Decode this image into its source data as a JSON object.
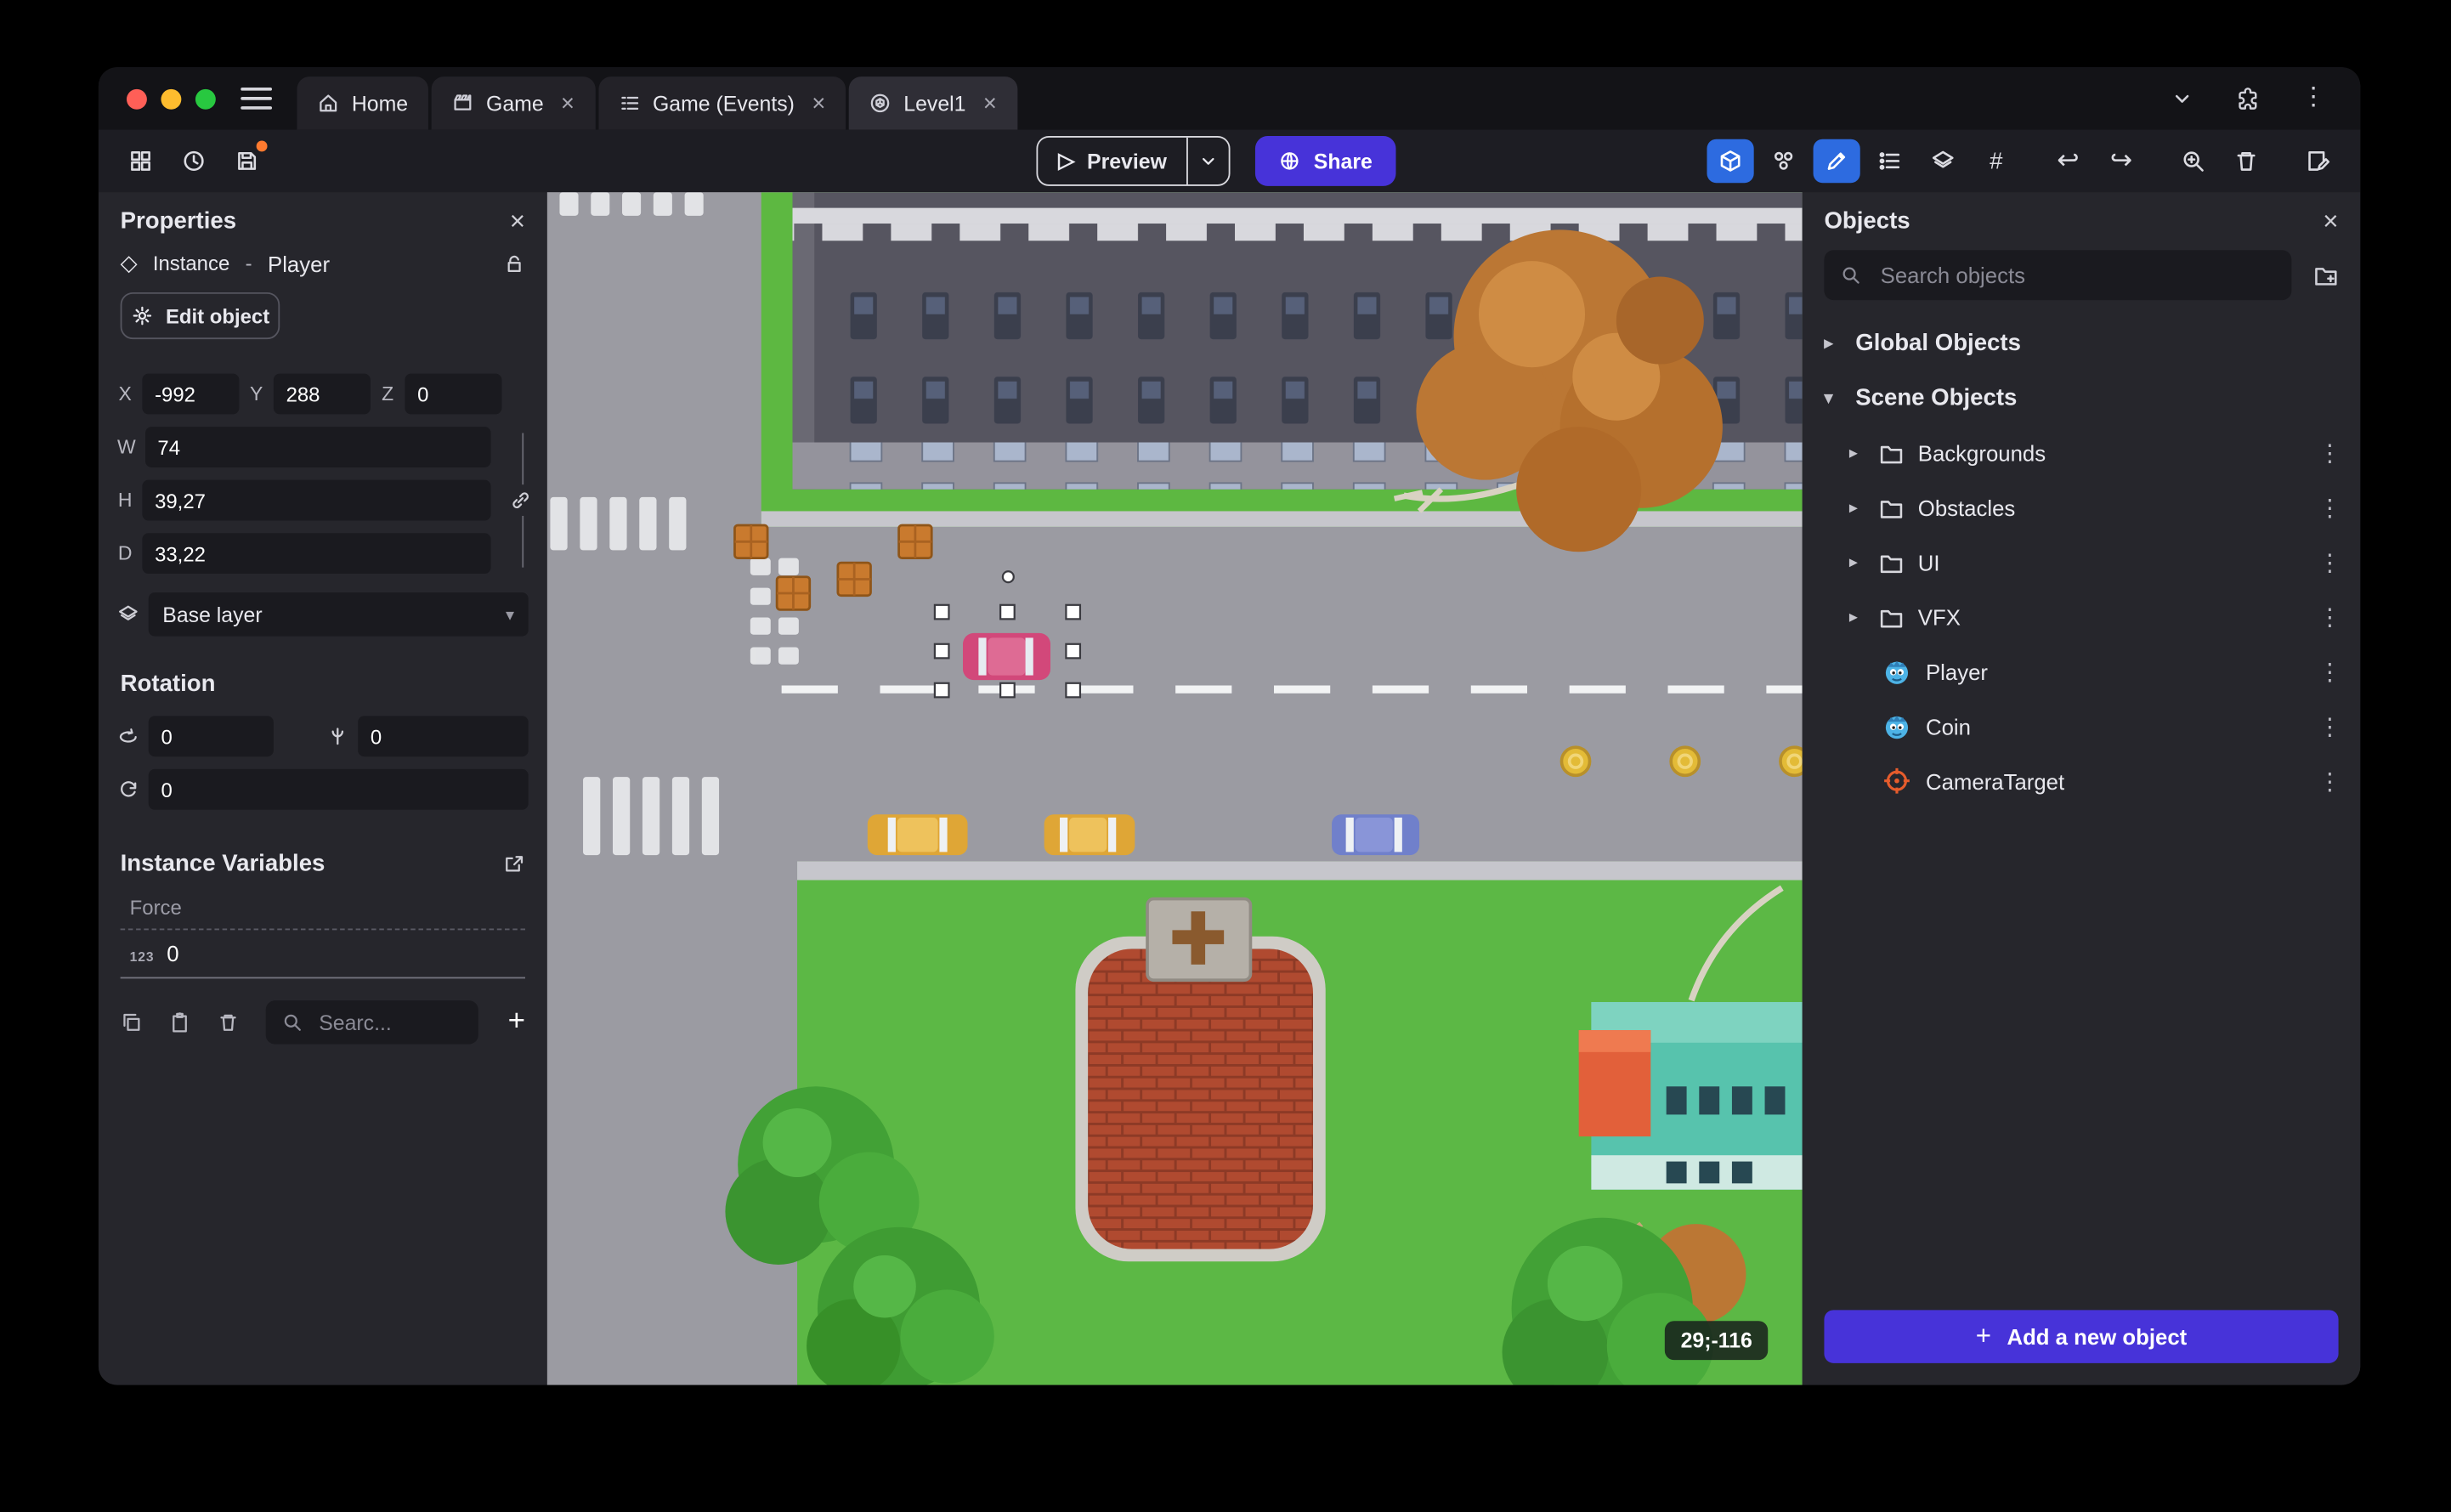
{
  "glyphs": {
    "close": "×",
    "kebab": "⋮",
    "chevron_right": "▸",
    "chevron_down": "▾",
    "undo": "↩",
    "redo": "↪",
    "play": "▷",
    "hash": "#",
    "plus": "+",
    "diamond": "◇"
  },
  "titlebar": {
    "tabs": [
      {
        "label": "Home"
      },
      {
        "label": "Game"
      },
      {
        "label": "Game (Events)"
      },
      {
        "label": "Level1"
      }
    ]
  },
  "toolbar": {
    "preview_label": "Preview",
    "share_label": "Share"
  },
  "properties": {
    "title": "Properties",
    "instance_kind": "Instance",
    "instance_sep": "-",
    "instance_name": "Player",
    "edit_object_label": "Edit object",
    "coords": {
      "x_label": "X",
      "x": "-992",
      "y_label": "Y",
      "y": "288",
      "z_label": "Z",
      "z": "0"
    },
    "size": {
      "w_label": "W",
      "w": "74",
      "h_label": "H",
      "h": "39,27",
      "d_label": "D",
      "d": "33,22"
    },
    "layer": "Base layer",
    "rotation_title": "Rotation",
    "rotation": {
      "x": "0",
      "y": "0",
      "z": "0"
    },
    "variables_title": "Instance Variables",
    "variables": [
      {
        "name": "Force",
        "type_badge": "123",
        "value": "0"
      }
    ],
    "search_placeholder": "Searc..."
  },
  "canvas": {
    "cursor_coordinates": "29;-116"
  },
  "objects_panel": {
    "title": "Objects",
    "search_placeholder": "Search objects",
    "groups": [
      {
        "label": "Global Objects",
        "expanded": false
      },
      {
        "label": "Scene Objects",
        "expanded": true
      }
    ],
    "folders": [
      {
        "label": "Backgrounds"
      },
      {
        "label": "Obstacles"
      },
      {
        "label": "UI"
      },
      {
        "label": "VFX"
      }
    ],
    "objects": [
      {
        "label": "Player",
        "icon": "sprite-creature-icon"
      },
      {
        "label": "Coin",
        "icon": "sprite-creature-icon"
      },
      {
        "label": "CameraTarget",
        "icon": "camera-target-icon"
      }
    ],
    "add_button_label": "Add a new object"
  },
  "colors": {
    "accent_purple": "#4733d9",
    "toolbar_active_blue": "#2d6be0",
    "unsaved_dot_orange": "#ff7a2f",
    "traffic_red": "#ff5f57",
    "traffic_yellow": "#febc2e",
    "traffic_green": "#28c840",
    "selection_handle": "#ffffff"
  }
}
